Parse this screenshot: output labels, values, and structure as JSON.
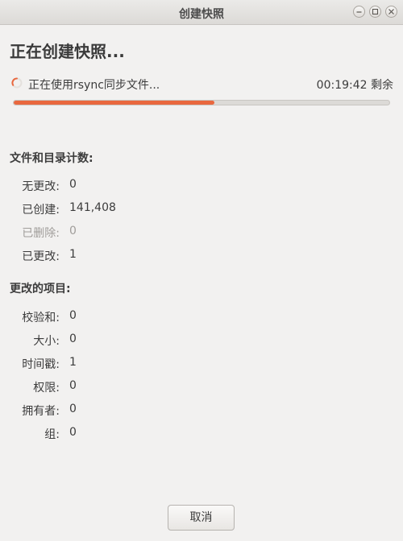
{
  "window": {
    "title": "创建快照"
  },
  "heading": "正在创建快照...",
  "status": {
    "text": "正在使用rsync同步文件...",
    "remaining": "00:19:42 剩余"
  },
  "progress": {
    "fraction": 0.535,
    "color": "#e9683f"
  },
  "file_counts": {
    "title": "文件和目录计数:",
    "rows": [
      {
        "label": "无更改:",
        "value": "0"
      },
      {
        "label": "已创建:",
        "value": "141,408"
      },
      {
        "label": "已删除:",
        "value": "0"
      },
      {
        "label": "已更改:",
        "value": "1"
      }
    ]
  },
  "changed_items": {
    "title": "更改的项目:",
    "rows": [
      {
        "label": "校验和:",
        "value": "0"
      },
      {
        "label": "大小:",
        "value": "0"
      },
      {
        "label": "时间戳:",
        "value": "1"
      },
      {
        "label": "权限:",
        "value": "0"
      },
      {
        "label": "拥有者:",
        "value": "0"
      },
      {
        "label": "组:",
        "value": "0"
      }
    ]
  },
  "buttons": {
    "cancel": "取消"
  },
  "icons": {
    "spinner": "spinner-icon",
    "minimize": "minimize-icon",
    "maximize": "maximize-icon",
    "close": "close-icon"
  }
}
